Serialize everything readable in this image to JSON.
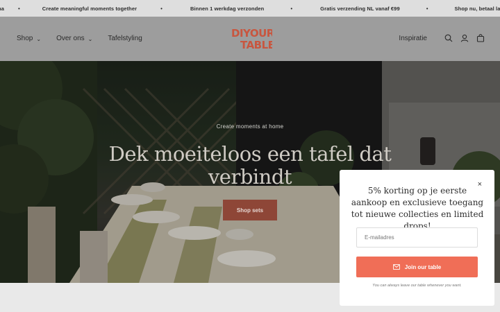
{
  "announcement": {
    "items": [
      "rna",
      "Create meaningful moments together",
      "Binnen 1 werkdag verzonden",
      "Gratis verzending NL vanaf €99",
      "Shop nu, betaal later met Klarna"
    ],
    "separator": "•"
  },
  "header": {
    "nav_left": [
      {
        "label": "Shop",
        "has_dropdown": true
      },
      {
        "label": "Over ons",
        "has_dropdown": true
      },
      {
        "label": "Tafelstyling",
        "has_dropdown": false
      }
    ],
    "logo": {
      "line1": "DIYOUR",
      "line2": "TABLE",
      "color": "#c8563f"
    },
    "nav_right": {
      "link": "Inspiratie",
      "icons": [
        "search-icon",
        "account-icon",
        "cart-icon"
      ]
    }
  },
  "hero": {
    "subtitle": "Create moments at home",
    "title": "Dek moeiteloos een tafel dat verbindt",
    "button": "Shop sets"
  },
  "popup": {
    "heading": "5% korting op je eerste aankoop en exclusieve toegang tot nieuwe collecties en limited drops!",
    "close": "×",
    "email_placeholder": "E-mailadres",
    "email_value": "",
    "button": "Join our table",
    "note": "You can always leave our table whenever you want.",
    "accent": "#f06e57"
  }
}
